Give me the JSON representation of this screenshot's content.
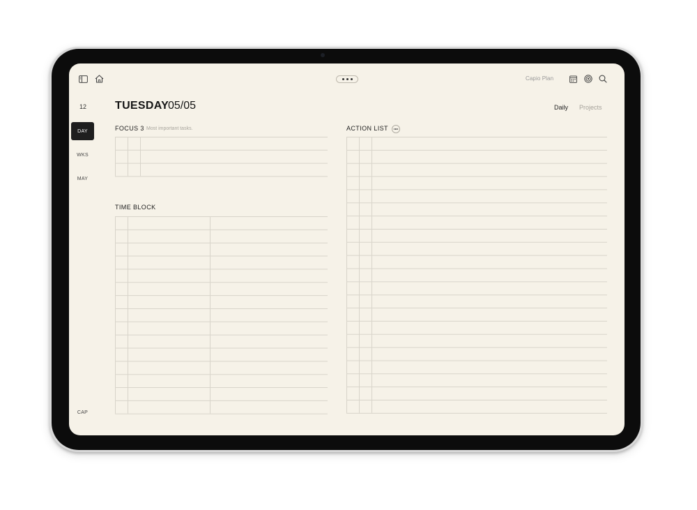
{
  "toolbar": {
    "app_name": "Capio Plan",
    "icons": [
      "sidebar-toggle-icon",
      "home-icon",
      "more-dots-icon",
      "calendar-icon",
      "target-icon",
      "search-icon"
    ]
  },
  "sidebar": {
    "number": "12",
    "items": [
      {
        "label": "DAY",
        "active": true
      },
      {
        "label": "WKS",
        "active": false
      },
      {
        "label": "MAY",
        "active": false
      }
    ],
    "bottom_label": "CAP"
  },
  "header": {
    "weekday": "TUESDAY",
    "date": "05/05"
  },
  "view_switch": {
    "options": [
      "Daily",
      "Projects"
    ],
    "selected": "Daily"
  },
  "focus": {
    "title": "FOCUS 3",
    "subtitle": "Most important tasks.",
    "rows": 3
  },
  "time_block": {
    "title": "TIME BLOCK",
    "rows": 15
  },
  "action_list": {
    "title": "ACTION LIST",
    "rows": 21
  },
  "colors": {
    "paper": "#f6f2e8",
    "grid_line": "#d8d4ca",
    "active_tab": "#1e1e1e",
    "text": "#151515",
    "muted": "#a5a29a"
  }
}
